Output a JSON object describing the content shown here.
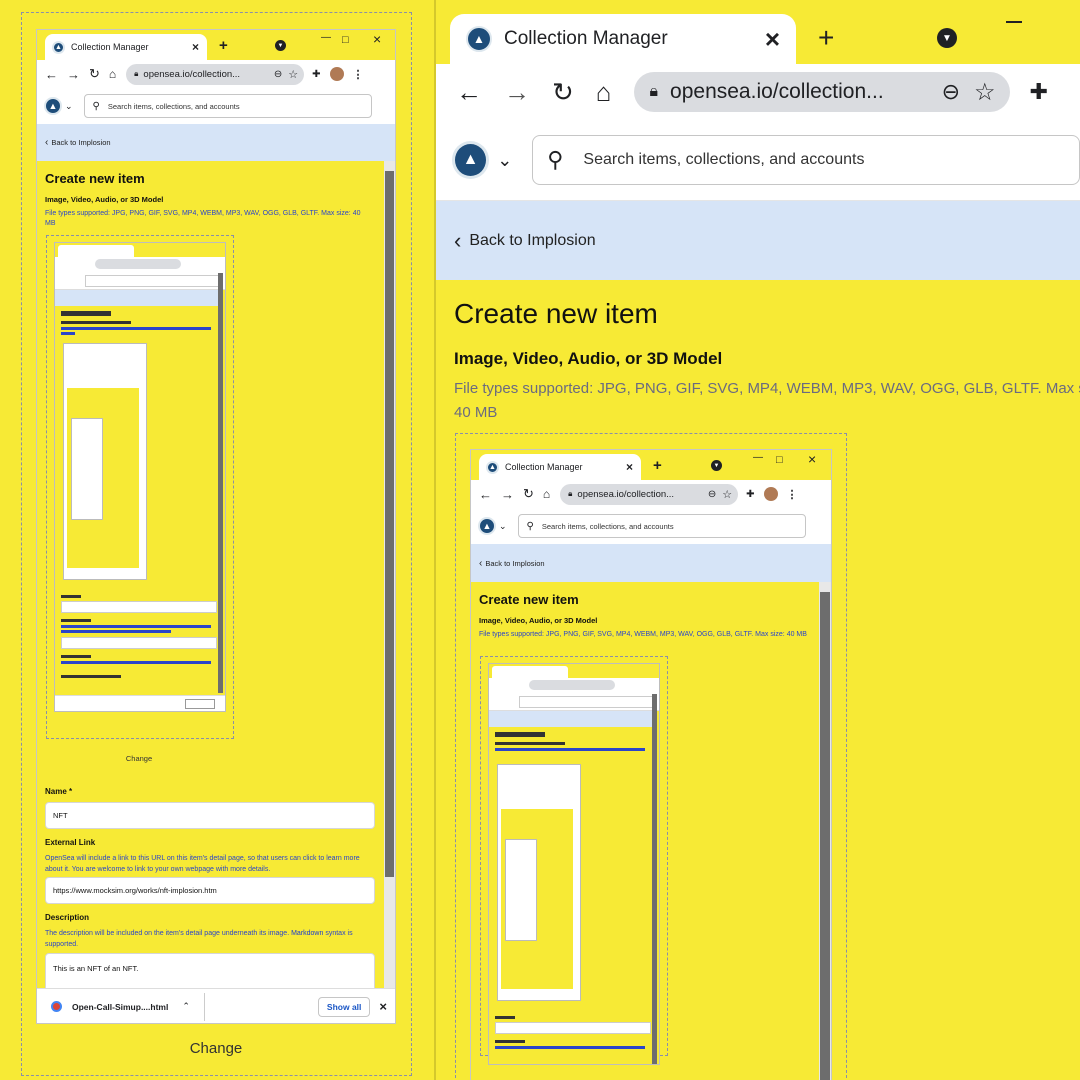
{
  "browser": {
    "tab_title": "Collection Manager",
    "tab_close": "×",
    "new_tab": "+",
    "minimize": "—",
    "maximize": "□",
    "close_window": "×",
    "url": "opensea.io/collection...",
    "url_short": "opensea.io/collection..."
  },
  "site": {
    "search_placeholder": "Search items, collections, and accounts",
    "back_label": "Back to Implosion"
  },
  "form": {
    "title": "Create new item",
    "media_label": "Image, Video, Audio, or 3D Model",
    "filetypes_left": "File types supported: JPG, PNG, GIF, SVG, MP4, WEBM, MP3, WAV, OGG, GLB, GLTF. Max size: 40 MB",
    "filetypes_right_line1": "File types supported: JPG, PNG, GIF, SVG, MP4, WEBM, MP3, WAV, OGG, GLB, GLTF. Max size:",
    "filetypes_right_line2": "40 MB",
    "change_label": "Change",
    "name_label": "Name *",
    "name_value": "NFT",
    "ext_link_label": "External Link",
    "ext_link_help": "OpenSea will include a link to this URL on this item's detail page, so that users can click to learn more about it. You are welcome to link to your own webpage with more details.",
    "ext_link_value": "https://www.mocksim.org/works/nft-implosion.htm",
    "desc_label": "Description",
    "desc_help_pre": "The description will be included on the item's detail page underneath its image. ",
    "desc_help_link": "Markdown",
    "desc_help_post": " syntax is supported.",
    "desc_value": "This is an NFT of an NFT."
  },
  "download": {
    "filename": "Open-Call-Simup....html",
    "show_all": "Show all",
    "close": "×"
  },
  "colors": {
    "background": "#f7ea35",
    "back_bar": "#d6e4f7",
    "link": "#2b45c9"
  }
}
